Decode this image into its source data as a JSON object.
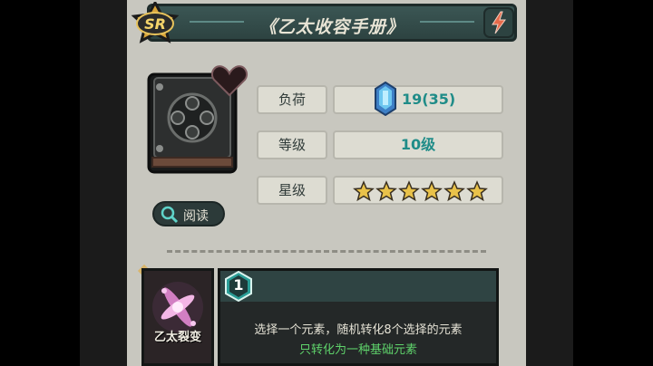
{
  "header": {
    "rarity": "SR",
    "title": "《乙太收容手册》",
    "bolt_icon": "lightning-icon"
  },
  "item": {
    "read_label": "阅读",
    "stats": [
      {
        "label": "负荷",
        "value": "19(35)",
        "icon": "crystal-load-icon"
      },
      {
        "label": "等级",
        "value": "10级"
      },
      {
        "label": "星级",
        "stars": 6
      }
    ]
  },
  "skill": {
    "name": "乙太裂变",
    "level": "1",
    "description": "选择一个元素，随机转化8个选择的元素",
    "note": "只转化为一种基础元素"
  },
  "colors": {
    "panel": "#c8c7bf",
    "title_bar": "#3b5654",
    "accent_teal": "#1f8c88",
    "star": "#e9c24a",
    "note_green": "#5fd36b"
  }
}
